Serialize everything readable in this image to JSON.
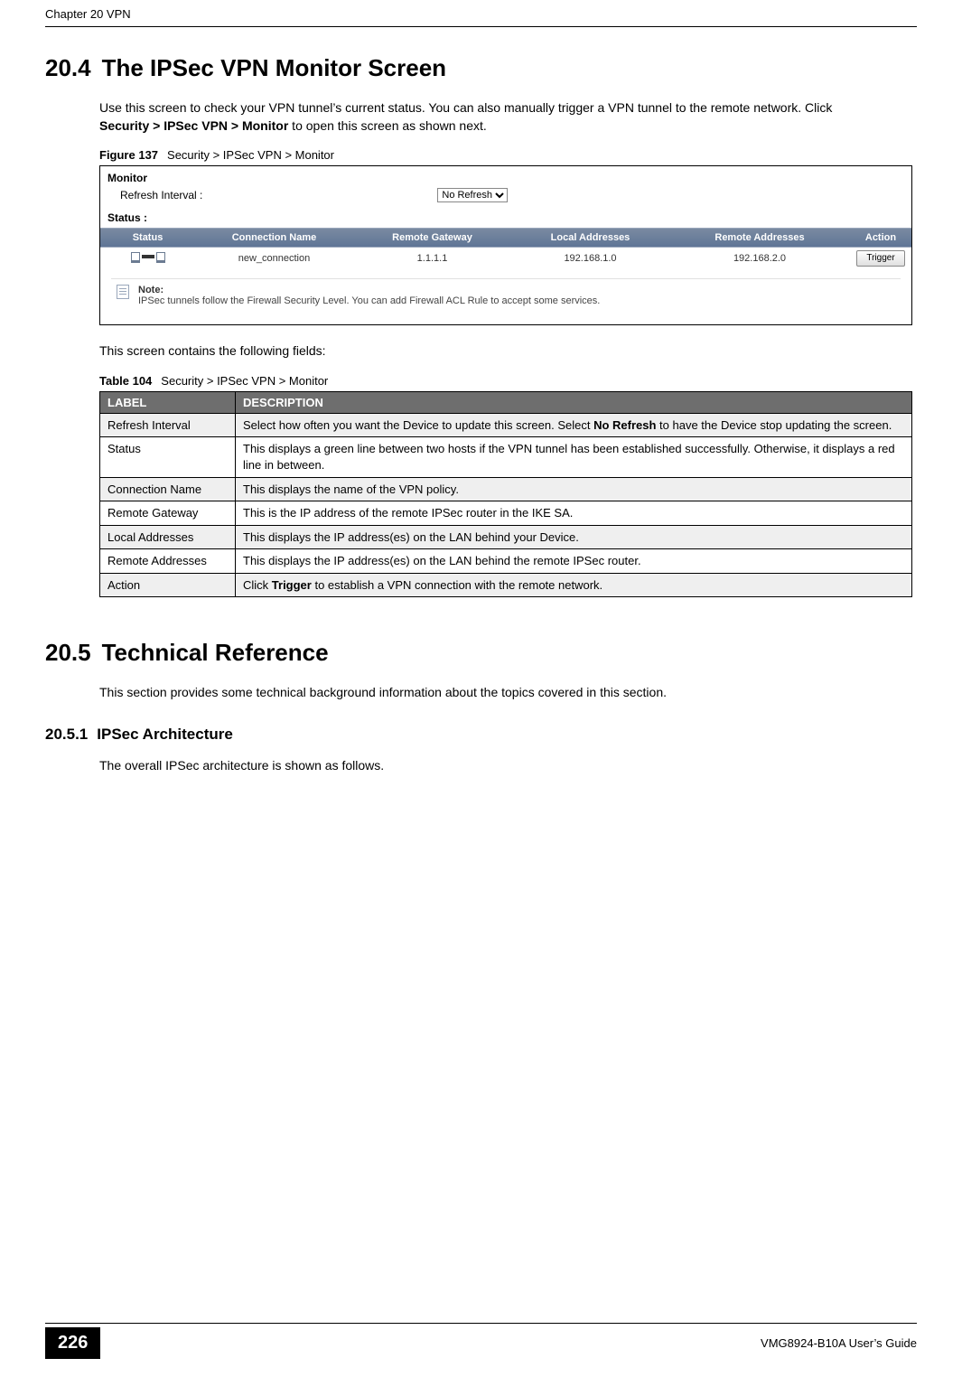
{
  "running_head": "Chapter 20 VPN",
  "section_20_4": {
    "number": "20.4",
    "title": "The IPSec VPN Monitor Screen",
    "para": "Use this screen to check your VPN tunnel’s current status. You can also manually trigger a VPN tunnel to the remote network. Click ",
    "para_bold": "Security > IPSec VPN > Monitor",
    "para_tail": " to open this screen as shown next."
  },
  "figure137": {
    "label": "Figure 137",
    "caption": "Security > IPSec VPN > Monitor",
    "ui": {
      "monitor_label": "Monitor",
      "refresh_label": "Refresh Interval :",
      "refresh_selected": "No Refresh",
      "status_heading": "Status :",
      "columns": {
        "status": "Status",
        "conn": "Connection Name",
        "rg": "Remote Gateway",
        "la": "Local Addresses",
        "ra": "Remote Addresses",
        "action": "Action"
      },
      "row": {
        "conn": "new_connection",
        "rg": "1.1.1.1",
        "la": "192.168.1.0",
        "ra": "192.168.2.0",
        "action_btn": "Trigger"
      },
      "note_label": "Note:",
      "note_text": "IPSec tunnels follow the Firewall Security Level. You can add Firewall ACL Rule to accept some services."
    }
  },
  "after_figure_para": "This screen contains the following fields:",
  "table104": {
    "label": "Table 104",
    "caption": "Security > IPSec VPN > Monitor",
    "headers": {
      "label": "LABEL",
      "desc": "DESCRIPTION"
    },
    "rows": [
      {
        "label": "Refresh Interval",
        "desc_pre": "Select how often you want the Device to update this screen. Select ",
        "desc_bold": "No Refresh",
        "desc_post": " to have the Device stop updating the screen."
      },
      {
        "label": "Status",
        "desc_pre": "This displays a green line between two hosts if the VPN tunnel has been established successfully. Otherwise, it displays a red line in between.",
        "desc_bold": "",
        "desc_post": ""
      },
      {
        "label": "Connection Name",
        "desc_pre": "This displays the name of the VPN policy.",
        "desc_bold": "",
        "desc_post": ""
      },
      {
        "label": "Remote Gateway",
        "desc_pre": "This is the IP address of the remote IPSec router in the IKE SA.",
        "desc_bold": "",
        "desc_post": ""
      },
      {
        "label": "Local Addresses",
        "desc_pre": "This displays the IP address(es) on the LAN behind your Device.",
        "desc_bold": "",
        "desc_post": ""
      },
      {
        "label": "Remote Addresses",
        "desc_pre": "This displays the IP address(es) on the LAN behind the remote IPSec router.",
        "desc_bold": "",
        "desc_post": ""
      },
      {
        "label": "Action",
        "desc_pre": "Click ",
        "desc_bold": "Trigger",
        "desc_post": " to establish a VPN connection with the remote network."
      }
    ]
  },
  "section_20_5": {
    "number": "20.5",
    "title": "Technical Reference",
    "para": "This section provides some technical background information about the topics covered in this section."
  },
  "section_20_5_1": {
    "number": "20.5.1",
    "title": "IPSec Architecture",
    "para": "The overall IPSec architecture is shown as follows."
  },
  "footer": {
    "page": "226",
    "guide": "VMG8924-B10A User’s Guide"
  }
}
